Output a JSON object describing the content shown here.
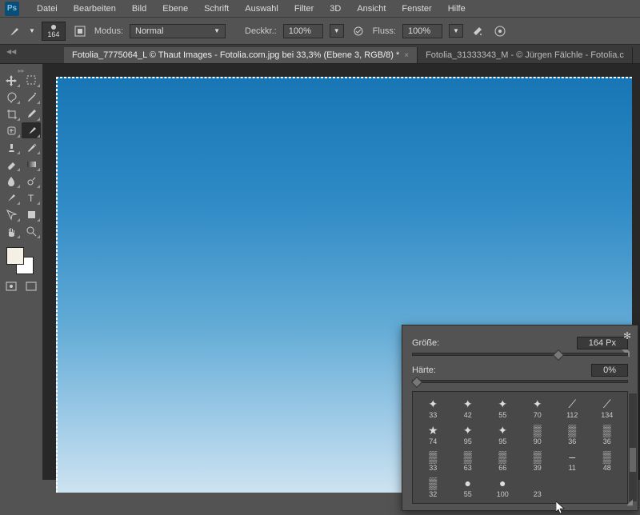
{
  "menu": [
    "Datei",
    "Bearbeiten",
    "Bild",
    "Ebene",
    "Schrift",
    "Auswahl",
    "Filter",
    "3D",
    "Ansicht",
    "Fenster",
    "Hilfe"
  ],
  "optionsBar": {
    "brushSize": "164",
    "modeLabel": "Modus:",
    "modeValue": "Normal",
    "opacityLabel": "Deckkr.:",
    "opacityValue": "100%",
    "flowLabel": "Fluss:",
    "flowValue": "100%"
  },
  "tabs": [
    {
      "label": "Fotolia_7775064_L © Thaut Images - Fotolia.com.jpg bei 33,3% (Ebene 3, RGB/8) *",
      "active": true
    },
    {
      "label": "Fotolia_31333343_M - © Jürgen Fälchle - Fotolia.c",
      "active": false
    }
  ],
  "brushPanel": {
    "sizeLabel": "Größe:",
    "sizeValue": "164 Px",
    "hardnessLabel": "Härte:",
    "hardnessValue": "0%",
    "presets": [
      {
        "s": "33",
        "i": "✦"
      },
      {
        "s": "42",
        "i": "✦"
      },
      {
        "s": "55",
        "i": "✦"
      },
      {
        "s": "70",
        "i": "✦"
      },
      {
        "s": "112",
        "i": "⟋"
      },
      {
        "s": "134",
        "i": "⟋"
      },
      {
        "s": "74",
        "i": "★"
      },
      {
        "s": "95",
        "i": "✦"
      },
      {
        "s": "95",
        "i": "✦"
      },
      {
        "s": "90",
        "i": "▒"
      },
      {
        "s": "36",
        "i": "▒"
      },
      {
        "s": "36",
        "i": "▒"
      },
      {
        "s": "33",
        "i": "▒"
      },
      {
        "s": "63",
        "i": "▒"
      },
      {
        "s": "66",
        "i": "▒"
      },
      {
        "s": "39",
        "i": "▒"
      },
      {
        "s": "11",
        "i": "–"
      },
      {
        "s": "48",
        "i": "▒"
      },
      {
        "s": "32",
        "i": "▒"
      },
      {
        "s": "55",
        "i": "●"
      },
      {
        "s": "100",
        "i": "●"
      },
      {
        "s": "23",
        "i": ""
      },
      {
        "s": "",
        "i": ""
      },
      {
        "s": "",
        "i": ""
      }
    ]
  },
  "tools": [
    [
      "move",
      "marquee"
    ],
    [
      "lasso",
      "wand"
    ],
    [
      "crop",
      "eyedrop"
    ],
    [
      "heal",
      "brush"
    ],
    [
      "stamp",
      "history"
    ],
    [
      "eraser",
      "gradient"
    ],
    [
      "blur",
      "dodge"
    ],
    [
      "pen",
      "type"
    ],
    [
      "path",
      "shape"
    ],
    [
      "hand",
      "zoom"
    ]
  ]
}
